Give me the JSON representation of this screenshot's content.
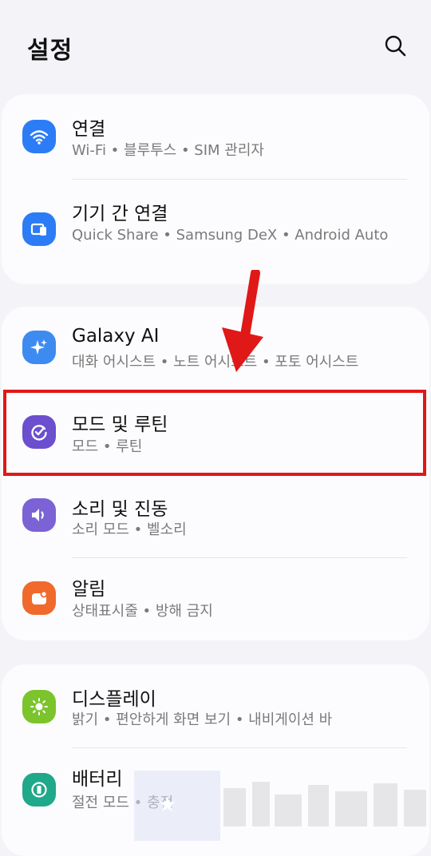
{
  "header": {
    "title": "설정",
    "search_icon": "search-icon"
  },
  "groups": [
    {
      "items": [
        {
          "title": "연결",
          "subtitle": "Wi-Fi  •  블루투스  •  SIM 관리자",
          "icon": "wifi-icon",
          "icon_color": "#2c7cf6"
        },
        {
          "title": "기기 간 연결",
          "subtitle": "Quick Share  •  Samsung DeX  •  Android Auto",
          "icon": "device-connect-icon",
          "icon_color": "#2c7cf6"
        }
      ]
    },
    {
      "items": [
        {
          "title": "Galaxy AI",
          "subtitle": "대화 어시스트  •  노트 어시스트  •  포토 어시스트",
          "icon": "sparkle-icon",
          "icon_color": "#3d8bf0"
        },
        {
          "title": "모드 및 루틴",
          "subtitle": "모드  •  루틴",
          "icon": "routine-check-icon",
          "icon_color": "#6b4fcf"
        },
        {
          "title": "소리 및 진동",
          "subtitle": "소리 모드  •  벨소리",
          "icon": "speaker-icon",
          "icon_color": "#7b63d6"
        },
        {
          "title": "알림",
          "subtitle": "상태표시줄  •  방해 금지",
          "icon": "notification-icon",
          "icon_color": "#f06a2c"
        }
      ]
    },
    {
      "items": [
        {
          "title": "디스플레이",
          "subtitle": "밝기  •  편안하게 화면 보기  •  내비게이션 바",
          "icon": "brightness-icon",
          "icon_color": "#7bc42c"
        },
        {
          "title": "배터리",
          "subtitle": "절전 모드  •  충전",
          "icon": "battery-icon",
          "icon_color": "#1fa88a"
        }
      ]
    }
  ],
  "annotation": {
    "highlight_color": "#e01818",
    "arrow_color": "#e01818"
  }
}
